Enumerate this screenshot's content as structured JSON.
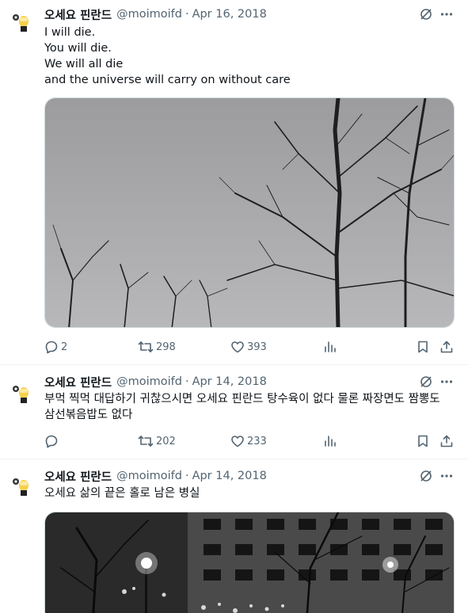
{
  "tweets": [
    {
      "author": "오세요 핀란드",
      "handle": "@moimoifd",
      "separator": "·",
      "date": "Apr 16, 2018",
      "lines": [
        "I will die.",
        "You will die.",
        "We will all die",
        "and the universe will carry on without care"
      ],
      "replies": "2",
      "reposts": "298",
      "likes": "393"
    },
    {
      "author": "오세요 핀란드",
      "handle": "@moimoifd",
      "separator": "·",
      "date": "Apr 14, 2018",
      "lines": [
        "부먹 찍먹 대답하기 귀찮으시면 오세요 핀란드 탕수육이 없다 물론 짜장면도 짬뽕도",
        "삼선볶음밥도 없다"
      ],
      "replies": "",
      "reposts": "202",
      "likes": "233"
    },
    {
      "author": "오세요 핀란드",
      "handle": "@moimoifd",
      "separator": "·",
      "date": "Apr 14, 2018",
      "lines": [
        "오세요 삶의 끝은 홀로 남은 병실"
      ]
    }
  ],
  "icons": {
    "avatar": "avatar-icon",
    "grok": "grok-icon",
    "more": "more-icon",
    "reply": "reply-icon",
    "repost": "repost-icon",
    "like": "like-icon",
    "views": "views-icon",
    "bookmark": "bookmark-icon",
    "share": "share-icon"
  },
  "colors": {
    "text": "#0f1419",
    "secondary": "#536471",
    "divider": "#eff3f4",
    "media_border": "#cfd9de"
  }
}
